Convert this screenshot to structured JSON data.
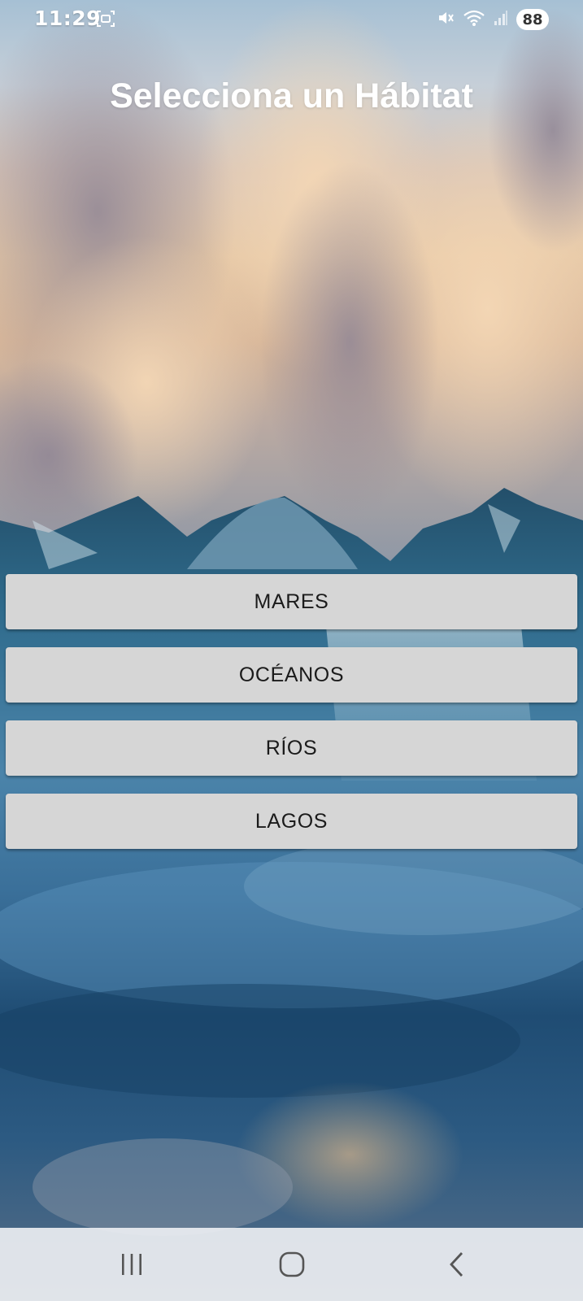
{
  "status_bar": {
    "time": "11:29",
    "battery": "88",
    "icons": [
      "screenshot-icon",
      "mute-icon",
      "wifi-icon",
      "signal-icon"
    ]
  },
  "title": "Selecciona un Hábitat",
  "habitats": [
    {
      "label": "MARES"
    },
    {
      "label": "OCÉANOS"
    },
    {
      "label": "RÍOS"
    },
    {
      "label": "LAGOS"
    }
  ],
  "nav_bar": {
    "icons": [
      "recent-apps-icon",
      "home-icon",
      "back-icon"
    ]
  },
  "colors": {
    "button_bg": "#d6d6d6",
    "button_text": "#1b1b1b",
    "title_text": "#ffffff"
  }
}
